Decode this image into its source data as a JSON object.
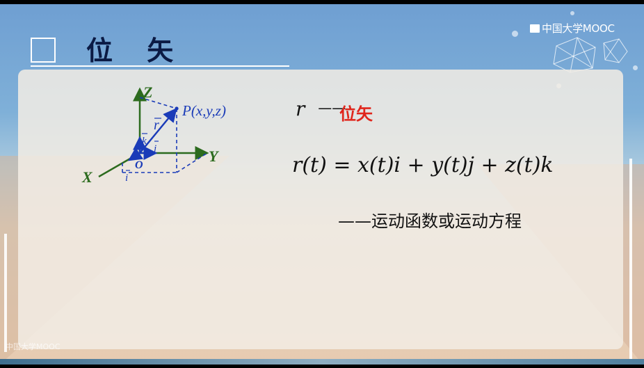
{
  "title": "位 矢",
  "logo": "中国大学MOOC",
  "diagram": {
    "z_label": "Z",
    "y_label": "Y",
    "x_label": "X",
    "origin_label": "O",
    "point_label": "P(x,y,z)",
    "r_label": "r",
    "k_label": "k",
    "j_label": "j",
    "i_label": "i"
  },
  "right": {
    "r_symbol": "r",
    "dash": "——",
    "r_meaning": "位矢",
    "equation": "r(t) = x(t)i + y(t)j + z(t)k",
    "description": "——运动函数或运动方程"
  },
  "watermark": "中国大学MOOC",
  "colors": {
    "accent_red": "#e0261c",
    "vector_blue": "#1a3bb8",
    "axis_green": "#2c6b1e"
  }
}
